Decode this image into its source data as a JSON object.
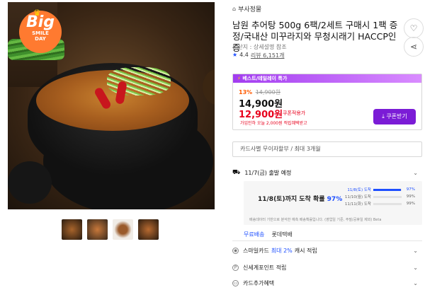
{
  "product_image": {
    "badge_big": "Big",
    "badge_line1": "SMILE",
    "badge_line2": "DAY"
  },
  "thumbnails": [
    {
      "alt": "thumbnail-1"
    },
    {
      "alt": "thumbnail-2"
    },
    {
      "alt": "thumbnail-3"
    },
    {
      "alt": "thumbnail-4"
    }
  ],
  "brand": {
    "name": "부사정물"
  },
  "title": "남원 추어탕 500g 6팩/2세트 구매시 1팩 증정/국내산 미꾸라지와 무청시래기 HACCP인증",
  "origin": "원산지 : 상세설명 참조",
  "rating": {
    "score": "4.4",
    "reviews": "리뷰 6,151개"
  },
  "pricing": {
    "best_label": "베스트/테일레이 특가",
    "discount_pct": "13%",
    "original_price": "14,900원",
    "price": "14,900원",
    "coupon_price": "12,900원",
    "coupon_label": "쿠폰적용가",
    "coupon_info": "가입인하 오늘 2,000원 적립혜택받고",
    "coupon_button": "쿠폰받기"
  },
  "card": {
    "text": "카드사별 무이자할부 / 최대 3개월"
  },
  "shipping": {
    "eta": "11/7(금) 출발 예정",
    "forecast": {
      "headline_prefix": "11/8(토)까지 도착 확률",
      "headline_pct": "97%",
      "rows": [
        {
          "date": "11/8(토) 도착",
          "pct": "97%",
          "fill": 0.97
        },
        {
          "date": "11/10(월) 도착",
          "pct": "99%",
          "fill": 0.99
        },
        {
          "date": "11/11(화) 도착",
          "pct": "99%",
          "fill": 0.99
        }
      ],
      "note": "배송데이터 기반으로 분석한 예측 배송확률입니다. (영업일 기준, 주말/공휴일 제외) Beta"
    },
    "free_shipping": "무료배송",
    "carrier": "롯데택배"
  },
  "benefits": [
    {
      "label": "스마일카드",
      "highlight": "최대 2%",
      "suffix": "캐시 적립"
    },
    {
      "label": "신세계포인트 적립",
      "highlight": "",
      "suffix": ""
    },
    {
      "label": "카드추가혜택",
      "highlight": "",
      "suffix": ""
    }
  ],
  "colors": {
    "accent_purple": "#7b1cd6",
    "price_red": "#e8001c",
    "link_blue": "#1e4fff",
    "discount_orange": "#ff5a00"
  }
}
